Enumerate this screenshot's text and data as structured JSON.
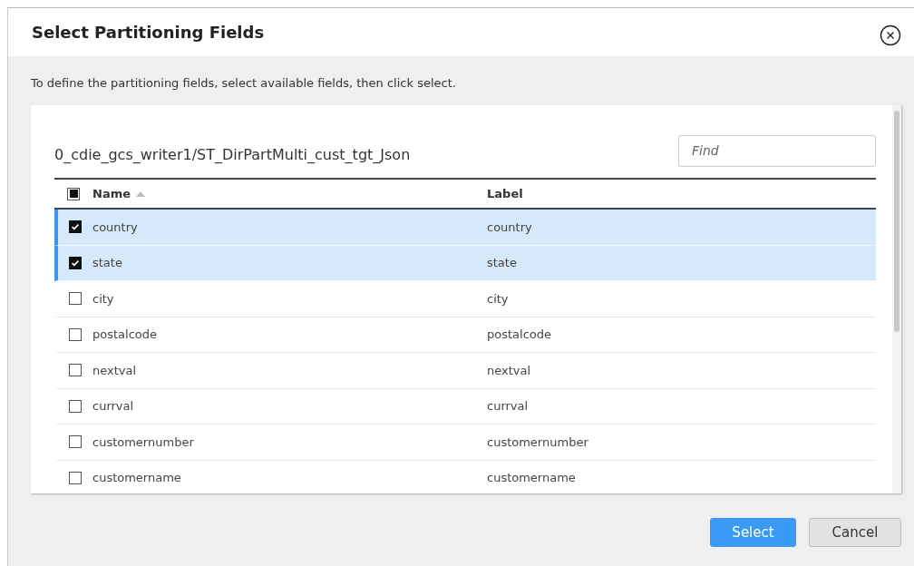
{
  "dialog": {
    "title": "Select Partitioning Fields",
    "instructions": "To define the partitioning fields, select available fields, then click select."
  },
  "panel": {
    "path": "0_cdie_gcs_writer1/ST_DirPartMulti_cust_tgt_Json",
    "search": {
      "placeholder": "Find"
    }
  },
  "table": {
    "select_all": {
      "indeterminate": true
    },
    "columns": [
      {
        "label": "Name",
        "sorted": true
      },
      {
        "label": "Label",
        "sorted": false
      }
    ],
    "rows": [
      {
        "name": "country",
        "label": "country",
        "selected": true
      },
      {
        "name": "state",
        "label": "state",
        "selected": true
      },
      {
        "name": "city",
        "label": "city",
        "selected": false
      },
      {
        "name": "postalcode",
        "label": "postalcode",
        "selected": false
      },
      {
        "name": "nextval",
        "label": "nextval",
        "selected": false
      },
      {
        "name": "currval",
        "label": "currval",
        "selected": false
      },
      {
        "name": "customernumber",
        "label": "customernumber",
        "selected": false
      },
      {
        "name": "customername",
        "label": "customername",
        "selected": false
      }
    ]
  },
  "buttons": [
    {
      "label": "Select",
      "kind": "primary"
    },
    {
      "label": "Cancel",
      "kind": "secondary"
    }
  ]
}
